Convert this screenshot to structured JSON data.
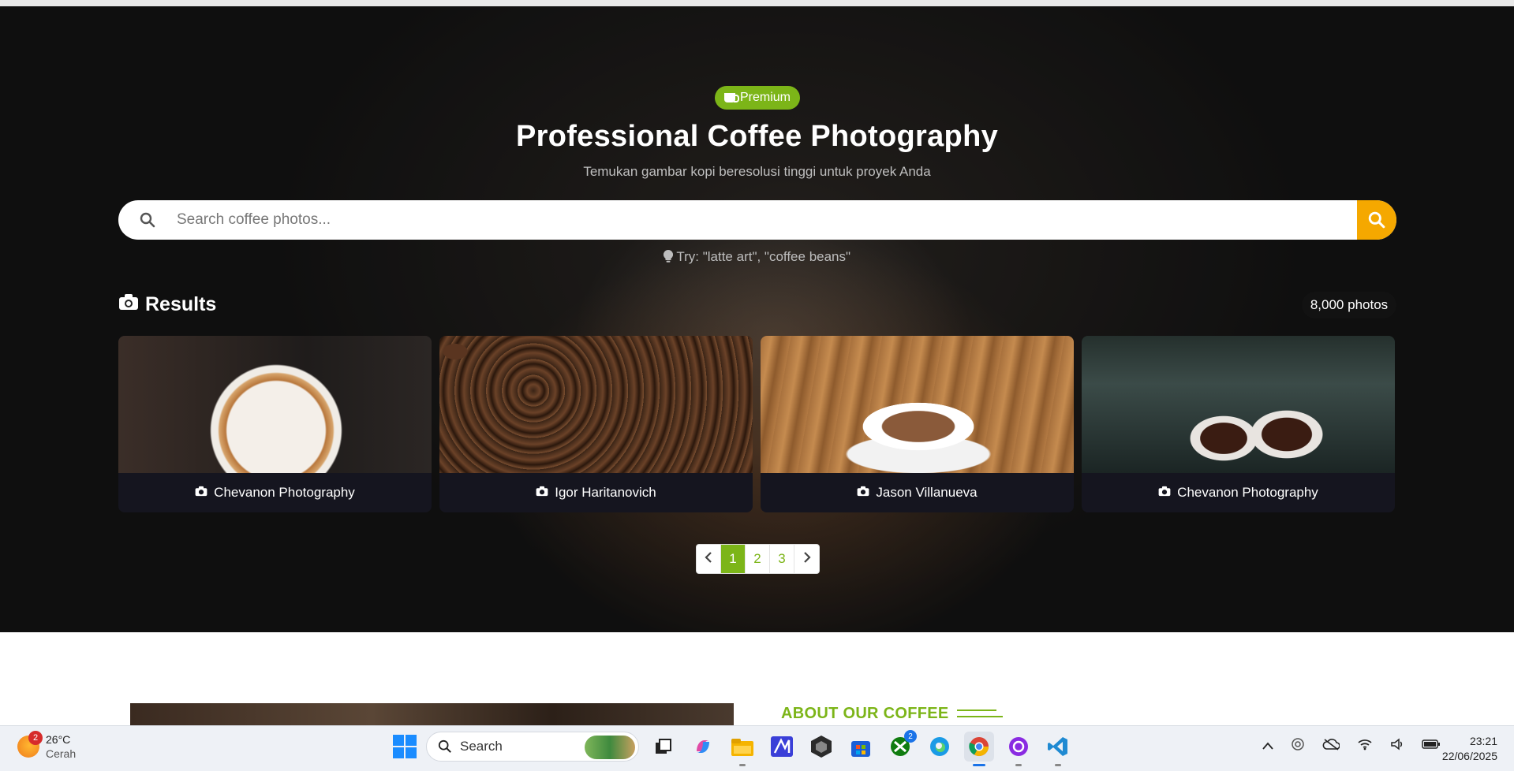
{
  "hero": {
    "badge": "Premium",
    "title": "Professional Coffee Photography",
    "subtitle": "Temukan gambar kopi beresolusi tinggi untuk proyek Anda",
    "search_placeholder": "Search coffee photos...",
    "hint": "Try: \"latte art\", \"coffee beans\""
  },
  "results": {
    "title": "Results",
    "count": "8,000 photos",
    "cards": [
      {
        "photographer": "Chevanon Photography",
        "image": "latte-art-pour"
      },
      {
        "photographer": "Igor Haritanovich",
        "image": "coffee-beans"
      },
      {
        "photographer": "Jason Villanueva",
        "image": "cup-on-wooden-table"
      },
      {
        "photographer": "Chevanon Photography",
        "image": "espresso-machine-pour"
      }
    ]
  },
  "pagination": {
    "pages": [
      "1",
      "2",
      "3"
    ],
    "active": "1"
  },
  "about": {
    "title": "ABOUT OUR COFFEE"
  },
  "taskbar": {
    "weather_temp": "26°C",
    "weather_desc": "Cerah",
    "weather_badge": "2",
    "search_label": "Search",
    "xbox_badge": "2",
    "time": "23:21",
    "date": "22/06/2025"
  },
  "colors": {
    "accent_green": "#7cb518",
    "search_button": "#f5a800"
  }
}
